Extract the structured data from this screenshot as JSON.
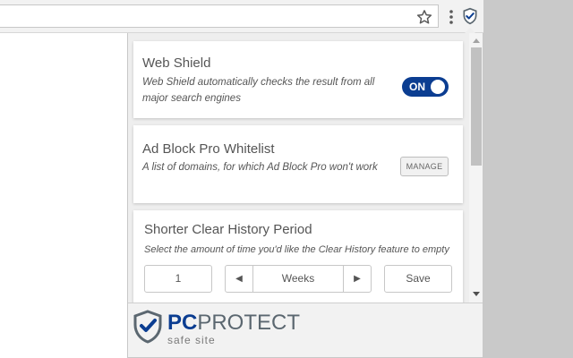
{
  "browser": {
    "star_icon": "star-outline-icon",
    "menu_icon": "kebab-menu-icon",
    "extension_icon": "shield-check-icon"
  },
  "cards": {
    "web_shield": {
      "title": "Web Shield",
      "description": "Web Shield automatically checks the result from all major search engines",
      "toggle_label": "ON",
      "toggle_on": true
    },
    "ad_block": {
      "title": "Ad Block Pro Whitelist",
      "description": "A list of domains, for which Ad Block Pro won't work",
      "manage_label": "MANAGE"
    },
    "clear_history": {
      "title": "Shorter Clear History Period",
      "description": "Select the amount of time you'd like the Clear History feature to empty",
      "amount_value": "1",
      "unit_value": "Weeks",
      "save_label": "Save"
    }
  },
  "footer": {
    "brand_pc": "PC",
    "brand_protect": "PROTECT",
    "tagline": "safe site"
  },
  "colors": {
    "brand_blue": "#0b3d91",
    "toggle_on": "#0b3d91",
    "brand_gray": "#5b6770",
    "panel_bg": "#eeeeee"
  }
}
